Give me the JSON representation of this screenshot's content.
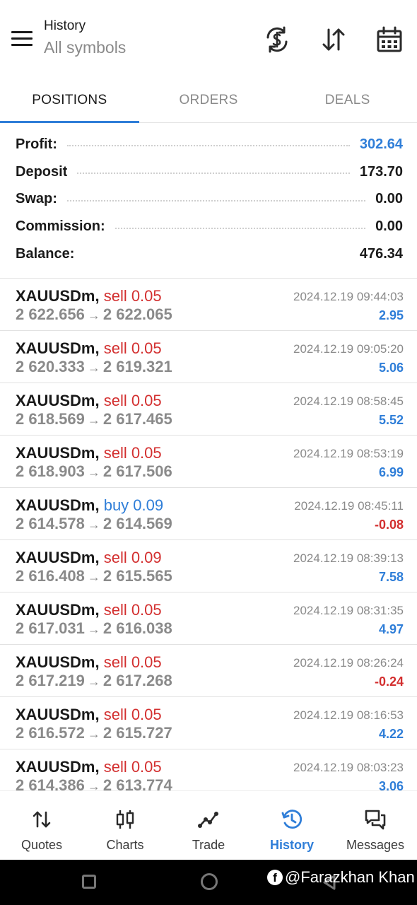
{
  "header": {
    "title": "History",
    "subtitle": "All symbols",
    "icons": [
      "menu-icon",
      "currency-sync-icon",
      "sort-icon",
      "calendar-icon"
    ]
  },
  "tabs": [
    {
      "label": "POSITIONS",
      "active": true
    },
    {
      "label": "ORDERS",
      "active": false
    },
    {
      "label": "DEALS",
      "active": false
    }
  ],
  "summary": [
    {
      "label": "Profit:",
      "value": "302.64",
      "highlight": true
    },
    {
      "label": "Deposit",
      "value": "173.70",
      "highlight": false
    },
    {
      "label": "Swap:",
      "value": "0.00",
      "highlight": false
    },
    {
      "label": "Commission:",
      "value": "0.00",
      "highlight": false
    },
    {
      "label": "Balance:",
      "value": "476.34",
      "highlight": false
    }
  ],
  "deals": [
    {
      "symbol": "XAUUSDm,",
      "side": "sell 0.05",
      "type": "sell",
      "open": "2 622.656",
      "close": "2 622.065",
      "time": "2024.12.19 09:44:03",
      "profit": "2.95",
      "positive": true
    },
    {
      "symbol": "XAUUSDm,",
      "side": "sell 0.05",
      "type": "sell",
      "open": "2 620.333",
      "close": "2 619.321",
      "time": "2024.12.19 09:05:20",
      "profit": "5.06",
      "positive": true
    },
    {
      "symbol": "XAUUSDm,",
      "side": "sell 0.05",
      "type": "sell",
      "open": "2 618.569",
      "close": "2 617.465",
      "time": "2024.12.19 08:58:45",
      "profit": "5.52",
      "positive": true
    },
    {
      "symbol": "XAUUSDm,",
      "side": "sell 0.05",
      "type": "sell",
      "open": "2 618.903",
      "close": "2 617.506",
      "time": "2024.12.19 08:53:19",
      "profit": "6.99",
      "positive": true
    },
    {
      "symbol": "XAUUSDm,",
      "side": "buy 0.09",
      "type": "buy",
      "open": "2 614.578",
      "close": "2 614.569",
      "time": "2024.12.19 08:45:11",
      "profit": "-0.08",
      "positive": false
    },
    {
      "symbol": "XAUUSDm,",
      "side": "sell 0.09",
      "type": "sell",
      "open": "2 616.408",
      "close": "2 615.565",
      "time": "2024.12.19 08:39:13",
      "profit": "7.58",
      "positive": true
    },
    {
      "symbol": "XAUUSDm,",
      "side": "sell 0.05",
      "type": "sell",
      "open": "2 617.031",
      "close": "2 616.038",
      "time": "2024.12.19 08:31:35",
      "profit": "4.97",
      "positive": true
    },
    {
      "symbol": "XAUUSDm,",
      "side": "sell 0.05",
      "type": "sell",
      "open": "2 617.219",
      "close": "2 617.268",
      "time": "2024.12.19 08:26:24",
      "profit": "-0.24",
      "positive": false
    },
    {
      "symbol": "XAUUSDm,",
      "side": "sell 0.05",
      "type": "sell",
      "open": "2 616.572",
      "close": "2 615.727",
      "time": "2024.12.19 08:16:53",
      "profit": "4.22",
      "positive": true
    },
    {
      "symbol": "XAUUSDm,",
      "side": "sell 0.05",
      "type": "sell",
      "open": "2 614.386",
      "close": "2 613.774",
      "time": "2024.12.19 08:03:23",
      "profit": "3.06",
      "positive": true
    }
  ],
  "arrow": "→",
  "nav": [
    {
      "label": "Quotes",
      "icon": "quotes-icon",
      "active": false
    },
    {
      "label": "Charts",
      "icon": "charts-icon",
      "active": false
    },
    {
      "label": "Trade",
      "icon": "trade-icon",
      "active": false
    },
    {
      "label": "History",
      "icon": "history-icon",
      "active": true
    },
    {
      "label": "Messages",
      "icon": "messages-icon",
      "active": false
    }
  ],
  "watermark": {
    "text": "@Farazkhan Khan",
    "logo": "f"
  },
  "colors": {
    "accent": "#2f7ed8",
    "sell": "#d32f2f",
    "negative": "#d32f2f",
    "muted": "#8a8a8a"
  }
}
